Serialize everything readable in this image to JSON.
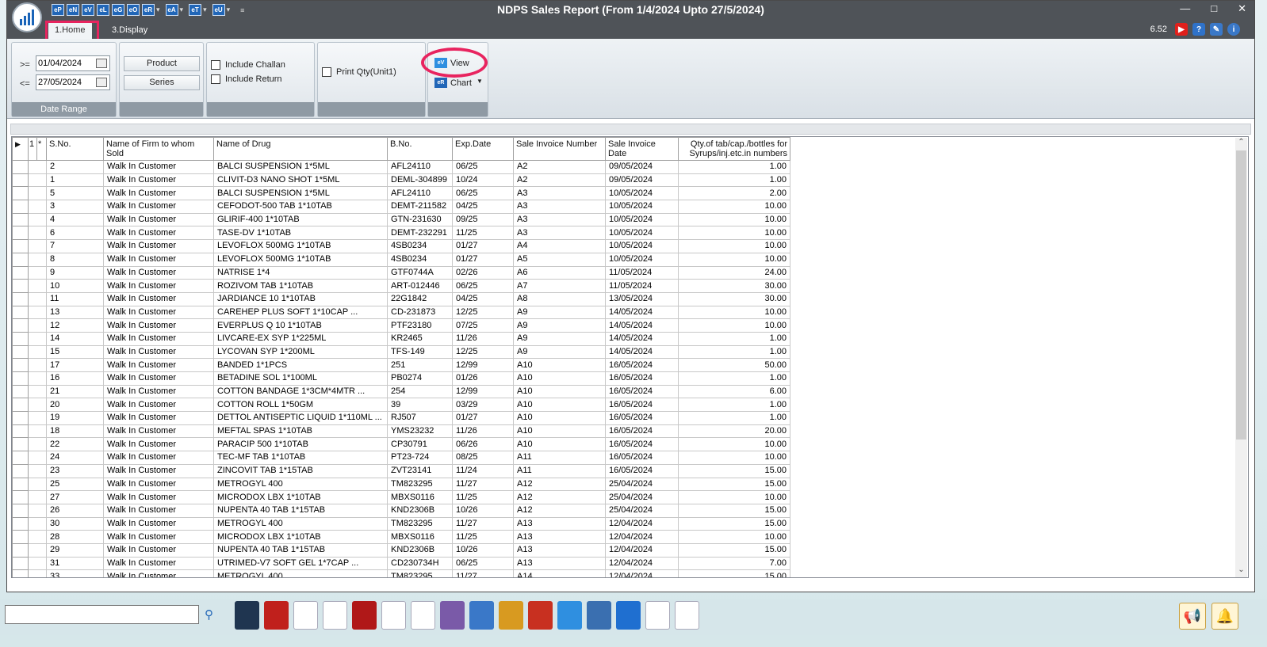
{
  "window": {
    "title": "NDPS Sales Report (From 1/4/2024 Upto 27/5/2024)",
    "version": "6.52"
  },
  "quick_access": [
    "eP",
    "eN",
    "eV",
    "eL",
    "eG",
    "eO",
    "eR",
    "eA",
    "eT",
    "eU"
  ],
  "tabs": [
    {
      "label": "1.Home"
    },
    {
      "label": "3.Display"
    }
  ],
  "ribbon": {
    "date_range": {
      "from_label": ">=",
      "from_value": "01/04/2024",
      "to_label": "<=",
      "to_value": "27/05/2024",
      "caption": "Date Range"
    },
    "product_label": "Product",
    "series_label": "Series",
    "include_challan": "Include Challan",
    "include_return": "Include Return",
    "print_qty": "Print Qty(Unit1)",
    "view_label": "View",
    "chart_label": "Chart"
  },
  "grid": {
    "row_indicator": "1",
    "sort_indicator": "*",
    "columns": [
      "S.No.",
      "Name of Firm to whom Sold",
      "Name of Drug",
      "B.No.",
      "Exp.Date",
      "Sale Invoice Number",
      "Sale Invoice Date",
      "Qty.of tab/cap./bottles for Syrups/inj.etc.in numbers"
    ],
    "rows": [
      [
        "2",
        "Walk In Customer",
        "BALCI SUSPENSION 1*5ML",
        "AFL24110",
        "06/25",
        "A2",
        "09/05/2024",
        "1.00"
      ],
      [
        "1",
        "Walk In Customer",
        "CLIVIT-D3 NANO SHOT 1*5ML",
        "DEML-304899",
        "10/24",
        "A2",
        "09/05/2024",
        "1.00"
      ],
      [
        "5",
        "Walk In Customer",
        "BALCI SUSPENSION 1*5ML",
        "AFL24110",
        "06/25",
        "A3",
        "10/05/2024",
        "2.00"
      ],
      [
        "3",
        "Walk In Customer",
        "CEFODOT-500 TAB 1*10TAB",
        "DEMT-211582",
        "04/25",
        "A3",
        "10/05/2024",
        "10.00"
      ],
      [
        "4",
        "Walk In Customer",
        "GLIRIF-400 1*10TAB",
        "GTN-231630",
        "09/25",
        "A3",
        "10/05/2024",
        "10.00"
      ],
      [
        "6",
        "Walk In Customer",
        "TASE-DV 1*10TAB",
        "DEMT-232291",
        "11/25",
        "A3",
        "10/05/2024",
        "10.00"
      ],
      [
        "7",
        "Walk In Customer",
        "LEVOFLOX 500MG 1*10TAB",
        "4SB0234",
        "01/27",
        "A4",
        "10/05/2024",
        "10.00"
      ],
      [
        "8",
        "Walk In Customer",
        "LEVOFLOX 500MG 1*10TAB",
        "4SB0234",
        "01/27",
        "A5",
        "10/05/2024",
        "10.00"
      ],
      [
        "9",
        "Walk In Customer",
        "NATRISE 1*4",
        "GTF0744A",
        "02/26",
        "A6",
        "11/05/2024",
        "24.00"
      ],
      [
        "10",
        "Walk In Customer",
        "ROZIVOM TAB 1*10TAB",
        "ART-012446",
        "06/25",
        "A7",
        "11/05/2024",
        "30.00"
      ],
      [
        "11",
        "Walk In Customer",
        "JARDIANCE 10 1*10TAB",
        "22G1842",
        "04/25",
        "A8",
        "13/05/2024",
        "30.00"
      ],
      [
        "13",
        "Walk In Customer",
        "CAREHEP PLUS SOFT 1*10CAP    ...",
        "CD-231873",
        "12/25",
        "A9",
        "14/05/2024",
        "10.00"
      ],
      [
        "12",
        "Walk In Customer",
        "EVERPLUS Q 10 1*10TAB",
        "PTF23180",
        "07/25",
        "A9",
        "14/05/2024",
        "10.00"
      ],
      [
        "14",
        "Walk In Customer",
        "LIVCARE-EX SYP 1*225ML",
        "KR2465",
        "11/26",
        "A9",
        "14/05/2024",
        "1.00"
      ],
      [
        "15",
        "Walk In Customer",
        "LYCOVAN SYP 1*200ML",
        "TFS-149",
        "12/25",
        "A9",
        "14/05/2024",
        "1.00"
      ],
      [
        "17",
        "Walk In Customer",
        "BANDED 1*1PCS",
        "251",
        "12/99",
        "A10",
        "16/05/2024",
        "50.00"
      ],
      [
        "16",
        "Walk In Customer",
        "BETADINE SOL 1*100ML",
        "PB0274",
        "01/26",
        "A10",
        "16/05/2024",
        "1.00"
      ],
      [
        "21",
        "Walk In Customer",
        "COTTON BANDAGE 1*3CM*4MTR      ...",
        "254",
        "12/99",
        "A10",
        "16/05/2024",
        "6.00"
      ],
      [
        "20",
        "Walk In Customer",
        "COTTON ROLL 1*50GM",
        "39",
        "03/29",
        "A10",
        "16/05/2024",
        "1.00"
      ],
      [
        "19",
        "Walk In Customer",
        "DETTOL ANTISEPTIC LIQUID 1*110ML ...",
        "RJ507",
        "01/27",
        "A10",
        "16/05/2024",
        "1.00"
      ],
      [
        "18",
        "Walk In Customer",
        "MEFTAL SPAS 1*10TAB",
        "YMS23232",
        "11/26",
        "A10",
        "16/05/2024",
        "20.00"
      ],
      [
        "22",
        "Walk In Customer",
        "PARACIP 500 1*10TAB",
        "CP30791",
        "06/26",
        "A10",
        "16/05/2024",
        "10.00"
      ],
      [
        "24",
        "Walk In Customer",
        "TEC-MF TAB 1*10TAB",
        "PT23-724",
        "08/25",
        "A11",
        "16/05/2024",
        "10.00"
      ],
      [
        "23",
        "Walk In Customer",
        "ZINCOVIT TAB 1*15TAB",
        "ZVT23141",
        "11/24",
        "A11",
        "16/05/2024",
        "15.00"
      ],
      [
        "25",
        "Walk In Customer",
        "METROGYL 400",
        "TM823295",
        "11/27",
        "A12",
        "25/04/2024",
        "15.00"
      ],
      [
        "27",
        "Walk In Customer",
        "MICRODOX LBX 1*10TAB",
        "MBXS0116",
        "11/25",
        "A12",
        "25/04/2024",
        "10.00"
      ],
      [
        "26",
        "Walk In Customer",
        "NUPENTA 40 TAB 1*15TAB",
        "KND2306B",
        "10/26",
        "A12",
        "25/04/2024",
        "15.00"
      ],
      [
        "30",
        "Walk In Customer",
        "METROGYL 400",
        "TM823295",
        "11/27",
        "A13",
        "12/04/2024",
        "15.00"
      ],
      [
        "28",
        "Walk In Customer",
        "MICRODOX LBX 1*10TAB",
        "MBXS0116",
        "11/25",
        "A13",
        "12/04/2024",
        "10.00"
      ],
      [
        "29",
        "Walk In Customer",
        "NUPENTA 40 TAB 1*15TAB",
        "KND2306B",
        "10/26",
        "A13",
        "12/04/2024",
        "15.00"
      ],
      [
        "31",
        "Walk In Customer",
        "UTRIMED-V7 SOFT GEL 1*7CAP     ...",
        "CD230734H",
        "06/25",
        "A13",
        "12/04/2024",
        "7.00"
      ],
      [
        "33",
        "Walk In Customer",
        "METROGYL 400",
        "TM823295",
        "11/27",
        "A14",
        "12/04/2024",
        "15.00"
      ]
    ]
  },
  "taskbar": {
    "search_value": "",
    "icons": [
      "app-1",
      "app-2",
      "app-3",
      "app-4",
      "app-5",
      "app-6",
      "app-7",
      "app-8",
      "app-9",
      "app-10",
      "app-11",
      "app-12",
      "app-13",
      "app-14",
      "app-15",
      "app-16",
      "app-17",
      "app-18"
    ]
  },
  "colors": {
    "highlight": "#e8245f",
    "titlebar": "#4f5358",
    "accent": "#2166b7"
  }
}
